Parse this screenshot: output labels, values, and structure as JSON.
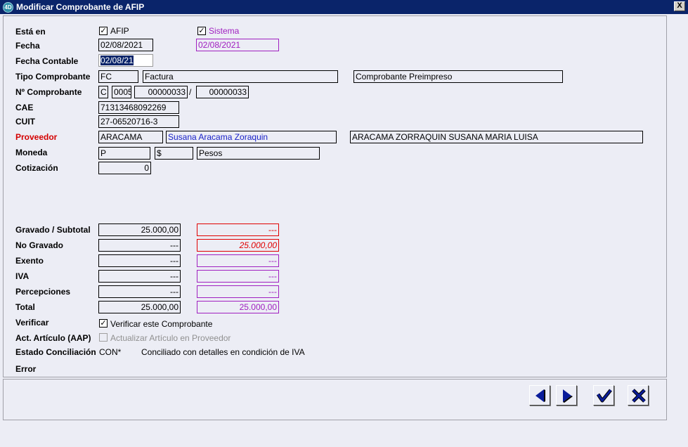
{
  "window": {
    "title": "Modificar Comprobante de AFIP",
    "app_icon": "4D",
    "close_label": "X"
  },
  "labels": {
    "esta_en": "Está en",
    "fecha": "Fecha",
    "fecha_contable": "Fecha Contable",
    "tipo_comprobante": "Tipo Comprobante",
    "nro_comprobante": "Nº Comprobante",
    "cae": "CAE",
    "cuit": "CUIT",
    "proveedor": "Proveedor",
    "moneda": "Moneda",
    "cotizacion": "Cotización",
    "gravado": "Gravado / Subtotal",
    "no_gravado": "No Gravado",
    "exento": "Exento",
    "iva": "IVA",
    "percepciones": "Percepciones",
    "total": "Total",
    "verificar": "Verificar",
    "act_articulo": "Act. Artículo (AAP)",
    "estado_conciliacion": "Estado Conciliación",
    "error": "Error"
  },
  "checks": {
    "afip": {
      "label": "AFIP",
      "checked": true
    },
    "sistema": {
      "label": "Sistema",
      "checked": true
    },
    "verificar": {
      "label": "Verificar este Comprobante",
      "checked": true
    },
    "actualizar": {
      "label": "Actualizar Artículo en Proveedor",
      "checked": false
    }
  },
  "fields": {
    "fecha_afip": "02/08/2021",
    "fecha_sistema": "02/08/2021",
    "fecha_contable": "02/08/21",
    "tipo_codigo": "FC",
    "tipo_desc": "Factura",
    "tipo_extra": "Comprobante Preimpreso",
    "nro_letra": "C",
    "nro_pv": "0005",
    "nro_desde": "00000033",
    "nro_sep": "/",
    "nro_hasta": "00000033",
    "cae": "71313468092269",
    "cuit": "27-06520716-3",
    "proveedor_codigo": "ARACAMA",
    "proveedor_nombre": "Susana Aracama Zoraquin",
    "proveedor_razon": "ARACAMA ZORRAQUIN SUSANA MARIA LUISA",
    "moneda_codigo": "P",
    "moneda_simbolo": "$",
    "moneda_desc": "Pesos",
    "cotizacion": "0"
  },
  "amounts": {
    "gravado_afip": "25.000,00",
    "gravado_sistema": "---",
    "no_gravado_afip": "---",
    "no_gravado_sistema": "25.000,00",
    "exento_afip": "---",
    "exento_sistema": "---",
    "iva_afip": "---",
    "iva_sistema": "---",
    "percepciones_afip": "---",
    "percepciones_sistema": "---",
    "total_afip": "25.000,00",
    "total_sistema": "25.000,00"
  },
  "estado": {
    "codigo": "CON*",
    "descripcion": "Conciliado con detalles en condición de IVA"
  },
  "buttons": [
    "previous-button",
    "next-button",
    "accept-button",
    "cancel-button"
  ],
  "colors": {
    "title_bar": "#0a246a",
    "purple": "#a020c0",
    "red": "#e00000",
    "blue": "#1a22c8",
    "nav_blue": "#0a1c9a"
  }
}
